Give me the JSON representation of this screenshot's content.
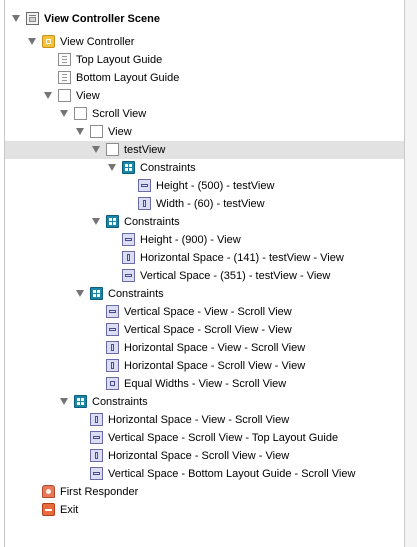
{
  "outline": {
    "scene_title": "View Controller Scene",
    "items": [
      {
        "label": "View Controller"
      },
      {
        "label": "Top Layout Guide"
      },
      {
        "label": "Bottom Layout Guide"
      },
      {
        "label": "View"
      },
      {
        "label": "Scroll View"
      },
      {
        "label": "View"
      },
      {
        "label": "testView"
      },
      {
        "label": "Constraints"
      },
      {
        "label": "Height - (500) - testView"
      },
      {
        "label": "Width - (60) - testView"
      },
      {
        "label": "Constraints"
      },
      {
        "label": "Height - (900) - View"
      },
      {
        "label": "Horizontal Space - (141) - testView - View"
      },
      {
        "label": "Vertical Space - (351) - testView - View"
      },
      {
        "label": "Constraints"
      },
      {
        "label": "Vertical Space - View - Scroll View"
      },
      {
        "label": "Vertical Space - Scroll View - View"
      },
      {
        "label": "Horizontal Space - View - Scroll View"
      },
      {
        "label": "Horizontal Space - Scroll View - View"
      },
      {
        "label": "Equal Widths - View - Scroll View"
      },
      {
        "label": "Constraints"
      },
      {
        "label": "Horizontal Space - View - Scroll View"
      },
      {
        "label": "Vertical Space - Scroll View - Top Layout Guide"
      },
      {
        "label": "Horizontal Space - Scroll View - View"
      },
      {
        "label": "Vertical Space - Bottom Layout Guide - Scroll View"
      },
      {
        "label": "First Responder"
      },
      {
        "label": "Exit"
      }
    ]
  },
  "icons": {
    "scene": "scene-icon",
    "view_controller": "view-controller-icon",
    "layout_guide": "layout-guide-icon",
    "view": "view-icon",
    "constraints": "constraints-icon",
    "constraint": "constraint-icon",
    "first_responder": "first-responder-icon",
    "exit": "exit-icon"
  },
  "colors": {
    "selection": "#e2e2e2",
    "constraints_group": "#1a86a8",
    "view_controller": "#f3c23a",
    "exit": "#e96a3c"
  }
}
